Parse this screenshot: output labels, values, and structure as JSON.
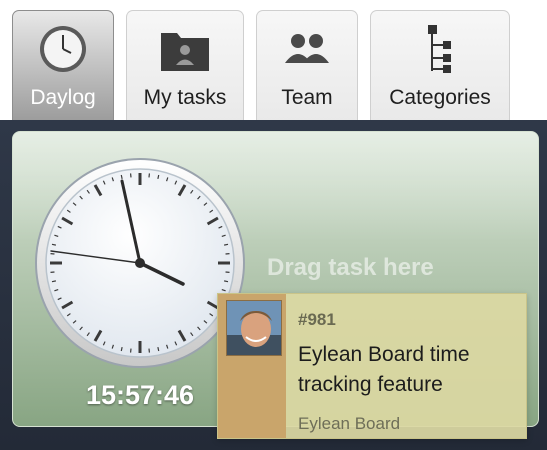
{
  "tabs": [
    {
      "label": "Daylog",
      "icon": "clock-icon",
      "active": true
    },
    {
      "label": "My tasks",
      "icon": "folder-user-icon",
      "active": false
    },
    {
      "label": "Team",
      "icon": "team-icon",
      "active": false
    },
    {
      "label": "Categories",
      "icon": "hierarchy-icon",
      "active": false
    }
  ],
  "daylog": {
    "time": "15:57:46",
    "drop_hint": "Drag task here"
  },
  "task_card": {
    "id": "#981",
    "title": "Eylean Board time tracking feature",
    "board": "Eylean Board",
    "avatar": "user-avatar"
  },
  "colors": {
    "panel_bg": "#2a3240",
    "card_green": "#a9c0a5",
    "task_yellow": "#dcd8a2",
    "task_strip": "#c9a56b"
  }
}
